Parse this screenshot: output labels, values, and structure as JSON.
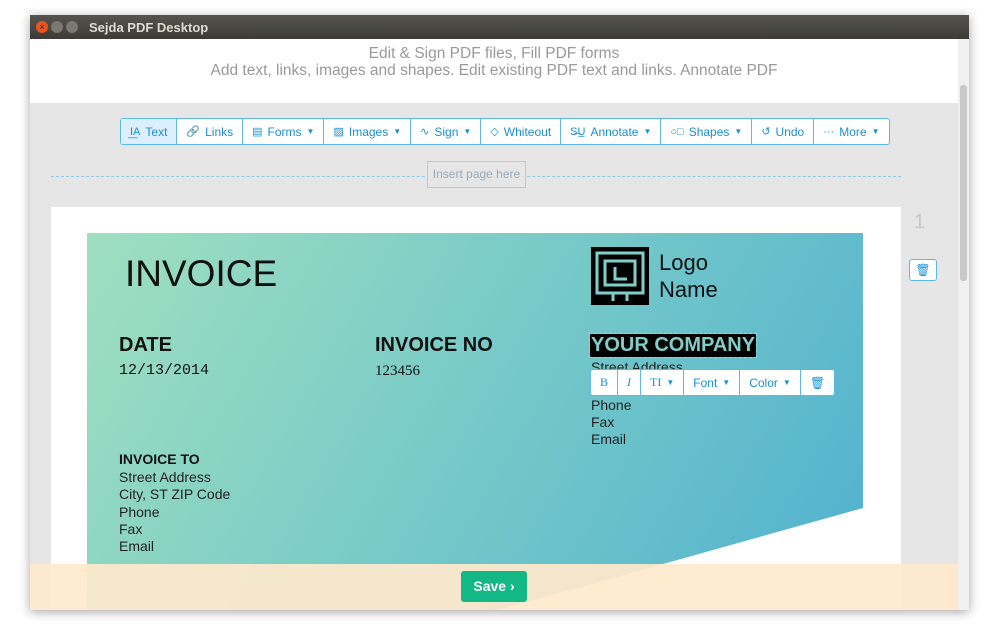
{
  "window": {
    "title": "Sejda PDF Desktop"
  },
  "header": {
    "line1": "Edit & Sign PDF files, Fill PDF forms",
    "line2": "Add text, links, images and shapes. Edit existing PDF text and links. Annotate PDF"
  },
  "toolbar": [
    {
      "label": "Text",
      "icon": "text-cursor-icon",
      "icon_glyph": "I͟A",
      "dropdown": false,
      "active": true
    },
    {
      "label": "Links",
      "icon": "link-icon",
      "icon_glyph": "🔗",
      "dropdown": false
    },
    {
      "label": "Forms",
      "icon": "form-icon",
      "icon_glyph": "▤",
      "dropdown": true
    },
    {
      "label": "Images",
      "icon": "image-icon",
      "icon_glyph": "▨",
      "dropdown": true
    },
    {
      "label": "Sign",
      "icon": "signature-icon",
      "icon_glyph": "∿",
      "dropdown": true
    },
    {
      "label": "Whiteout",
      "icon": "eraser-icon",
      "icon_glyph": "◇",
      "dropdown": false
    },
    {
      "label": "Annotate",
      "icon": "annotate-icon",
      "icon_glyph": "S̶U̲",
      "dropdown": true
    },
    {
      "label": "Shapes",
      "icon": "shapes-icon",
      "icon_glyph": "○□",
      "dropdown": true
    },
    {
      "label": "Undo",
      "icon": "undo-icon",
      "icon_glyph": "↺",
      "dropdown": false
    },
    {
      "label": "More",
      "icon": "more-icon",
      "icon_glyph": "···",
      "dropdown": true
    }
  ],
  "insert_page": "Insert page here",
  "page_number": "1",
  "invoice": {
    "title": "INVOICE",
    "logo_line1": "Logo",
    "logo_line2": "Name",
    "date_label": "DATE",
    "date_value": "12/13/2014",
    "invoice_no_label": "INVOICE NO",
    "invoice_no_value": "123456",
    "company": "YOUR COMPANY",
    "company_lines": [
      "Street Address",
      "Phone",
      "Fax",
      "Email"
    ],
    "to_label": "INVOICE TO",
    "to_lines": [
      "Street Address",
      "City, ST ZIP Code",
      "Phone",
      "Fax",
      "Email"
    ]
  },
  "format_toolbar": {
    "bold": "B",
    "italic": "I",
    "size": "TI",
    "font": "Font",
    "color": "Color"
  },
  "save_label": "Save",
  "colors": {
    "accent": "#1a8fd6",
    "save": "#14b887"
  }
}
